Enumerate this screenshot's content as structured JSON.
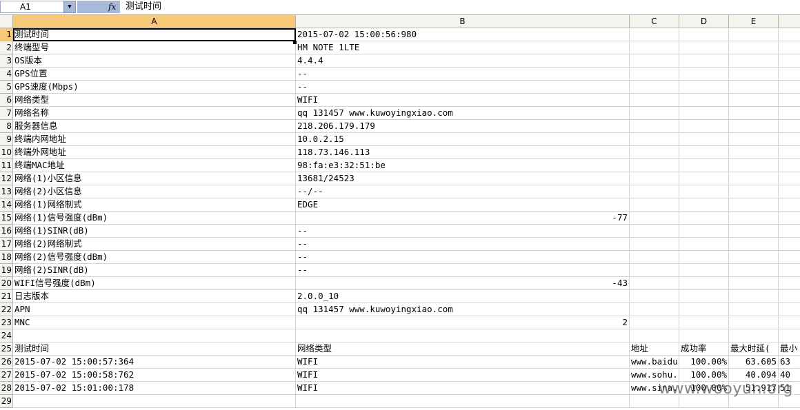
{
  "formula_bar": {
    "name_box": "A1",
    "fx_label": "fx",
    "content": "测试时间"
  },
  "columns": [
    "A",
    "B",
    "C",
    "D",
    "E",
    ""
  ],
  "rows": [
    {
      "num": "1",
      "a": "测试时间",
      "b": "2015-07-02 15:00:56:980"
    },
    {
      "num": "2",
      "a": "终端型号",
      "b": "HM NOTE 1LTE"
    },
    {
      "num": "3",
      "a": "OS版本",
      "b": "4.4.4"
    },
    {
      "num": "4",
      "a": "GPS位置",
      "b": "--"
    },
    {
      "num": "5",
      "a": "GPS速度(Mbps)",
      "b": "--"
    },
    {
      "num": "6",
      "a": "网络类型",
      "b": "WIFI"
    },
    {
      "num": "7",
      "a": "网络名称",
      "b": "qq 131457 www.kuwoyingxiao.com"
    },
    {
      "num": "8",
      "a": "服务器信息",
      "b": "218.206.179.179"
    },
    {
      "num": "9",
      "a": "终端内网地址",
      "b": "10.0.2.15"
    },
    {
      "num": "10",
      "a": "终端外网地址",
      "b": "118.73.146.113"
    },
    {
      "num": "11",
      "a": "终端MAC地址",
      "b": "98:fa:e3:32:51:be"
    },
    {
      "num": "12",
      "a": "网络(1)小区信息",
      "b": "13681/24523"
    },
    {
      "num": "13",
      "a": "网络(2)小区信息",
      "b": "--/--"
    },
    {
      "num": "14",
      "a": "网络(1)网络制式",
      "b": "EDGE"
    },
    {
      "num": "15",
      "a": "网络(1)信号强度(dBm)",
      "b": "-77",
      "b_num": true
    },
    {
      "num": "16",
      "a": "网络(1)SINR(dB)",
      "b": "--"
    },
    {
      "num": "17",
      "a": "网络(2)网络制式",
      "b": "--"
    },
    {
      "num": "18",
      "a": "网络(2)信号强度(dBm)",
      "b": "--"
    },
    {
      "num": "19",
      "a": "网络(2)SINR(dB)",
      "b": "--"
    },
    {
      "num": "20",
      "a": "WIFI信号强度(dBm)",
      "b": "-43",
      "b_num": true
    },
    {
      "num": "21",
      "a": "日志版本",
      "b": "2.0.0_10"
    },
    {
      "num": "22",
      "a": "APN",
      "b": "qq 131457 www.kuwoyingxiao.com"
    },
    {
      "num": "23",
      "a": "MNC",
      "b": "2",
      "b_num": true
    },
    {
      "num": "24",
      "a": "",
      "b": ""
    },
    {
      "num": "25",
      "a": "测试时间",
      "b": "网络类型",
      "c": "地址",
      "d": "成功率",
      "e": "最大时延(",
      "f": "最小"
    },
    {
      "num": "26",
      "a": "2015-07-02 15:00:57:364",
      "b": "WIFI",
      "c": "www.baidu",
      "d": "100.00%",
      "e": "63.605",
      "f": "63",
      "d_num": true,
      "e_num": true
    },
    {
      "num": "27",
      "a": "2015-07-02 15:00:58:762",
      "b": "WIFI",
      "c": "www.sohu.",
      "d": "100.00%",
      "e": "40.094",
      "f": "40",
      "d_num": true,
      "e_num": true
    },
    {
      "num": "28",
      "a": "2015-07-02 15:01:00:178",
      "b": "WIFI",
      "c": "www.sina.",
      "d": "100.00%",
      "e": "51.917",
      "f": "51",
      "d_num": true,
      "e_num": true
    },
    {
      "num": "29",
      "a": "",
      "b": ""
    }
  ],
  "watermark": "www.wooyun.org"
}
